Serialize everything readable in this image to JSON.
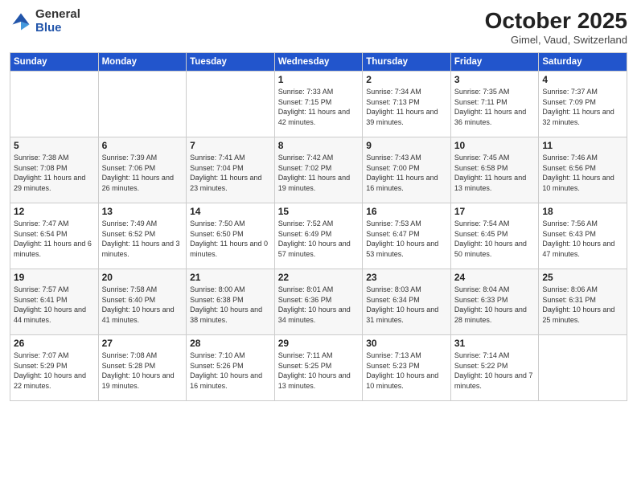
{
  "header": {
    "logo_general": "General",
    "logo_blue": "Blue",
    "month_title": "October 2025",
    "location": "Gimel, Vaud, Switzerland"
  },
  "weekdays": [
    "Sunday",
    "Monday",
    "Tuesday",
    "Wednesday",
    "Thursday",
    "Friday",
    "Saturday"
  ],
  "weeks": [
    [
      {
        "day": "",
        "sunrise": "",
        "sunset": "",
        "daylight": ""
      },
      {
        "day": "",
        "sunrise": "",
        "sunset": "",
        "daylight": ""
      },
      {
        "day": "",
        "sunrise": "",
        "sunset": "",
        "daylight": ""
      },
      {
        "day": "1",
        "sunrise": "Sunrise: 7:33 AM",
        "sunset": "Sunset: 7:15 PM",
        "daylight": "Daylight: 11 hours and 42 minutes."
      },
      {
        "day": "2",
        "sunrise": "Sunrise: 7:34 AM",
        "sunset": "Sunset: 7:13 PM",
        "daylight": "Daylight: 11 hours and 39 minutes."
      },
      {
        "day": "3",
        "sunrise": "Sunrise: 7:35 AM",
        "sunset": "Sunset: 7:11 PM",
        "daylight": "Daylight: 11 hours and 36 minutes."
      },
      {
        "day": "4",
        "sunrise": "Sunrise: 7:37 AM",
        "sunset": "Sunset: 7:09 PM",
        "daylight": "Daylight: 11 hours and 32 minutes."
      }
    ],
    [
      {
        "day": "5",
        "sunrise": "Sunrise: 7:38 AM",
        "sunset": "Sunset: 7:08 PM",
        "daylight": "Daylight: 11 hours and 29 minutes."
      },
      {
        "day": "6",
        "sunrise": "Sunrise: 7:39 AM",
        "sunset": "Sunset: 7:06 PM",
        "daylight": "Daylight: 11 hours and 26 minutes."
      },
      {
        "day": "7",
        "sunrise": "Sunrise: 7:41 AM",
        "sunset": "Sunset: 7:04 PM",
        "daylight": "Daylight: 11 hours and 23 minutes."
      },
      {
        "day": "8",
        "sunrise": "Sunrise: 7:42 AM",
        "sunset": "Sunset: 7:02 PM",
        "daylight": "Daylight: 11 hours and 19 minutes."
      },
      {
        "day": "9",
        "sunrise": "Sunrise: 7:43 AM",
        "sunset": "Sunset: 7:00 PM",
        "daylight": "Daylight: 11 hours and 16 minutes."
      },
      {
        "day": "10",
        "sunrise": "Sunrise: 7:45 AM",
        "sunset": "Sunset: 6:58 PM",
        "daylight": "Daylight: 11 hours and 13 minutes."
      },
      {
        "day": "11",
        "sunrise": "Sunrise: 7:46 AM",
        "sunset": "Sunset: 6:56 PM",
        "daylight": "Daylight: 11 hours and 10 minutes."
      }
    ],
    [
      {
        "day": "12",
        "sunrise": "Sunrise: 7:47 AM",
        "sunset": "Sunset: 6:54 PM",
        "daylight": "Daylight: 11 hours and 6 minutes."
      },
      {
        "day": "13",
        "sunrise": "Sunrise: 7:49 AM",
        "sunset": "Sunset: 6:52 PM",
        "daylight": "Daylight: 11 hours and 3 minutes."
      },
      {
        "day": "14",
        "sunrise": "Sunrise: 7:50 AM",
        "sunset": "Sunset: 6:50 PM",
        "daylight": "Daylight: 11 hours and 0 minutes."
      },
      {
        "day": "15",
        "sunrise": "Sunrise: 7:52 AM",
        "sunset": "Sunset: 6:49 PM",
        "daylight": "Daylight: 10 hours and 57 minutes."
      },
      {
        "day": "16",
        "sunrise": "Sunrise: 7:53 AM",
        "sunset": "Sunset: 6:47 PM",
        "daylight": "Daylight: 10 hours and 53 minutes."
      },
      {
        "day": "17",
        "sunrise": "Sunrise: 7:54 AM",
        "sunset": "Sunset: 6:45 PM",
        "daylight": "Daylight: 10 hours and 50 minutes."
      },
      {
        "day": "18",
        "sunrise": "Sunrise: 7:56 AM",
        "sunset": "Sunset: 6:43 PM",
        "daylight": "Daylight: 10 hours and 47 minutes."
      }
    ],
    [
      {
        "day": "19",
        "sunrise": "Sunrise: 7:57 AM",
        "sunset": "Sunset: 6:41 PM",
        "daylight": "Daylight: 10 hours and 44 minutes."
      },
      {
        "day": "20",
        "sunrise": "Sunrise: 7:58 AM",
        "sunset": "Sunset: 6:40 PM",
        "daylight": "Daylight: 10 hours and 41 minutes."
      },
      {
        "day": "21",
        "sunrise": "Sunrise: 8:00 AM",
        "sunset": "Sunset: 6:38 PM",
        "daylight": "Daylight: 10 hours and 38 minutes."
      },
      {
        "day": "22",
        "sunrise": "Sunrise: 8:01 AM",
        "sunset": "Sunset: 6:36 PM",
        "daylight": "Daylight: 10 hours and 34 minutes."
      },
      {
        "day": "23",
        "sunrise": "Sunrise: 8:03 AM",
        "sunset": "Sunset: 6:34 PM",
        "daylight": "Daylight: 10 hours and 31 minutes."
      },
      {
        "day": "24",
        "sunrise": "Sunrise: 8:04 AM",
        "sunset": "Sunset: 6:33 PM",
        "daylight": "Daylight: 10 hours and 28 minutes."
      },
      {
        "day": "25",
        "sunrise": "Sunrise: 8:06 AM",
        "sunset": "Sunset: 6:31 PM",
        "daylight": "Daylight: 10 hours and 25 minutes."
      }
    ],
    [
      {
        "day": "26",
        "sunrise": "Sunrise: 7:07 AM",
        "sunset": "Sunset: 5:29 PM",
        "daylight": "Daylight: 10 hours and 22 minutes."
      },
      {
        "day": "27",
        "sunrise": "Sunrise: 7:08 AM",
        "sunset": "Sunset: 5:28 PM",
        "daylight": "Daylight: 10 hours and 19 minutes."
      },
      {
        "day": "28",
        "sunrise": "Sunrise: 7:10 AM",
        "sunset": "Sunset: 5:26 PM",
        "daylight": "Daylight: 10 hours and 16 minutes."
      },
      {
        "day": "29",
        "sunrise": "Sunrise: 7:11 AM",
        "sunset": "Sunset: 5:25 PM",
        "daylight": "Daylight: 10 hours and 13 minutes."
      },
      {
        "day": "30",
        "sunrise": "Sunrise: 7:13 AM",
        "sunset": "Sunset: 5:23 PM",
        "daylight": "Daylight: 10 hours and 10 minutes."
      },
      {
        "day": "31",
        "sunrise": "Sunrise: 7:14 AM",
        "sunset": "Sunset: 5:22 PM",
        "daylight": "Daylight: 10 hours and 7 minutes."
      },
      {
        "day": "",
        "sunrise": "",
        "sunset": "",
        "daylight": ""
      }
    ]
  ]
}
